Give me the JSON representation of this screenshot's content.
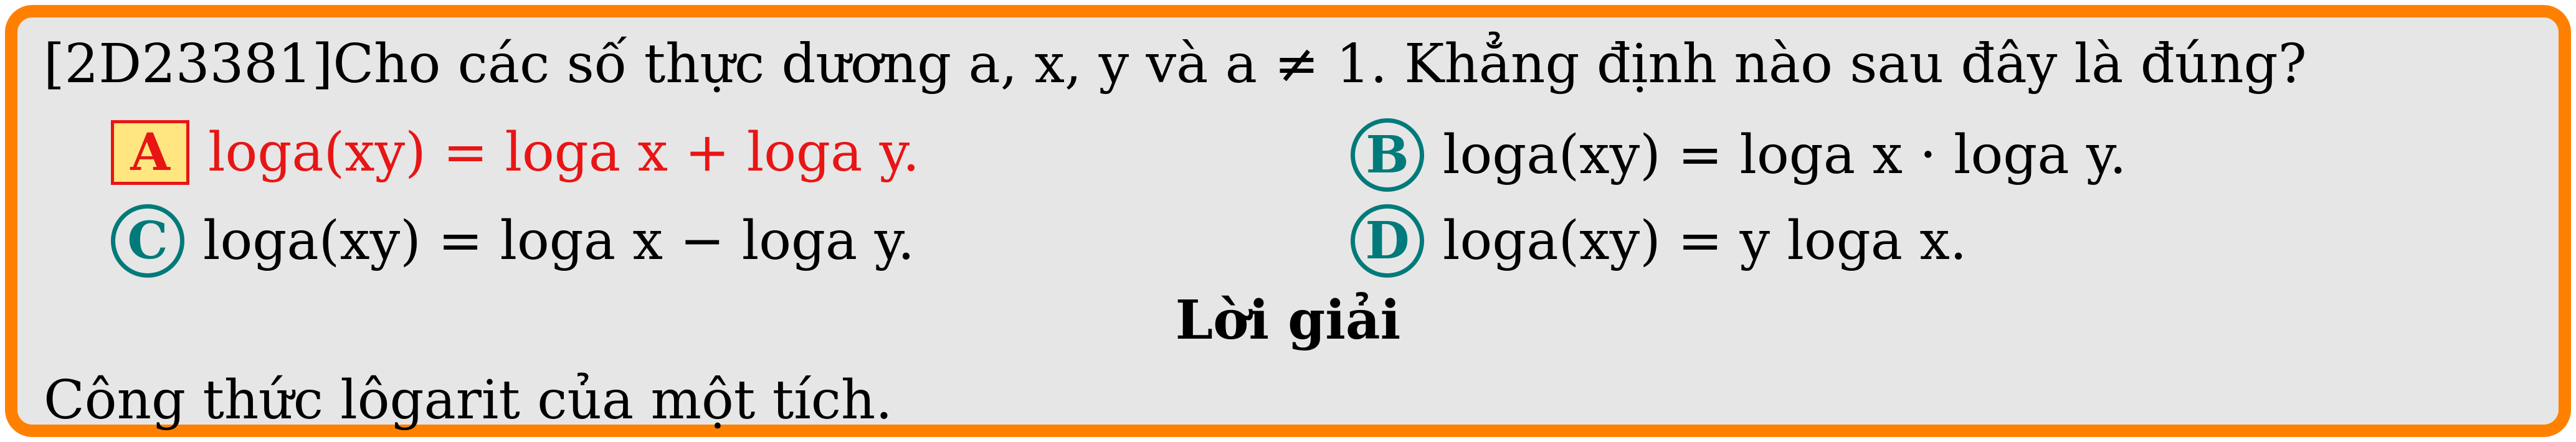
{
  "question": {
    "id": "[2D23381]",
    "text": "Cho các số thực dương a,  x,  y và a ≠ 1. Khẳng định nào sau đây là đúng?"
  },
  "options": [
    {
      "label": "A",
      "expr": "loga(xy) = loga x + loga y.",
      "correct": true
    },
    {
      "label": "B",
      "expr": "loga(xy) = loga x · loga y.",
      "correct": false
    },
    {
      "label": "C",
      "expr": "loga(xy) = loga x − loga y.",
      "correct": false
    },
    {
      "label": "D",
      "expr": "loga(xy) = y loga x.",
      "correct": false
    }
  ],
  "solution": {
    "heading": "Lời giải",
    "text": "Công thức lôgarit của một tích."
  },
  "colors": {
    "frame": "#ff8000",
    "background": "#e6e6e6",
    "correct": "#e81515",
    "badge": "#007a7a",
    "highlight": "#ffe680"
  }
}
